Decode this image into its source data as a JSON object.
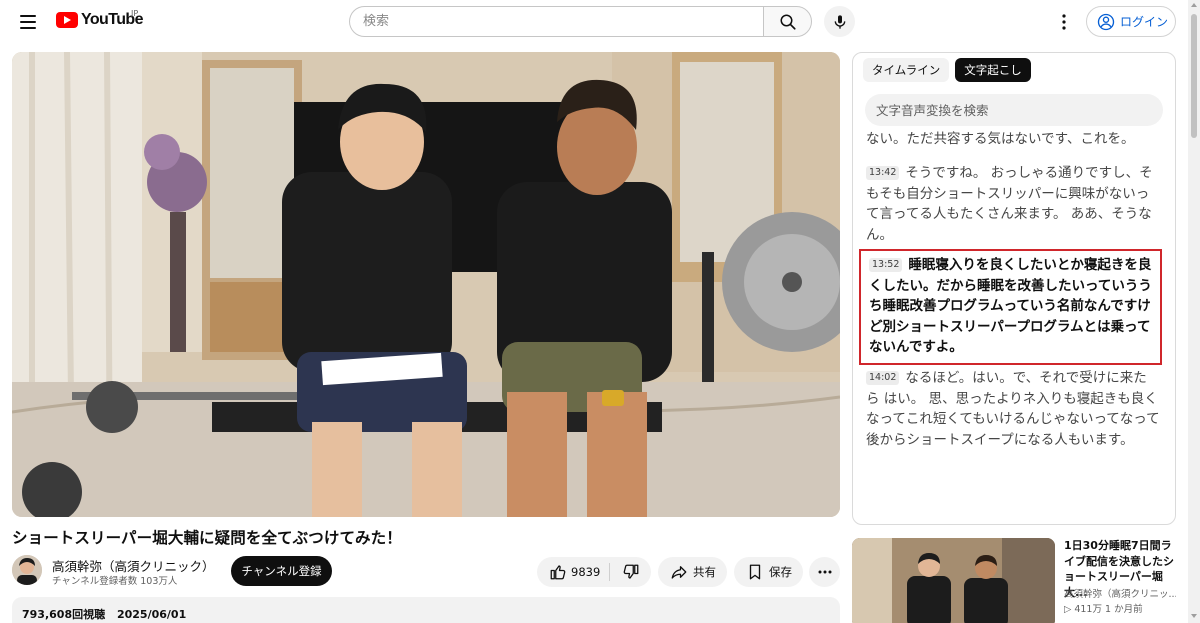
{
  "header": {
    "logo_text": "YouTube",
    "region": "JP",
    "search_placeholder": "検索",
    "login_label": "ログイン"
  },
  "video": {
    "title": "ショートスリーパー堀大輔に疑問を全てぶつけてみた！",
    "channel": "高須幹弥（高須クリニック）",
    "subscribers": "チャンネル登録者数 103万人",
    "subscribe_label": "チャンネル登録",
    "like_count": "9839",
    "share_label": "共有",
    "save_label": "保存",
    "views": "793,608回視聴",
    "date": "2025/06/01"
  },
  "panel": {
    "tabs": [
      {
        "label": "タイムライン",
        "active": false
      },
      {
        "label": "文字起こし",
        "active": true
      }
    ],
    "search_placeholder": "文字音声変換を検索",
    "segments": [
      {
        "time": "",
        "text": "ない。ただ共容する気はないです、これを。"
      },
      {
        "time": "13:42",
        "text": "そうですね。 おっしゃる通りですし、そもそも自分ショートスリッパーに興味がないって言ってる人もたくさん来ます。 ああ、そうなん。"
      },
      {
        "time": "13:52",
        "text": "睡眠寝入りを良くしたいとか寝起きを良くしたい。だから睡眠を改善したいっていううち睡眠改善プログラムっていう名前なんですけど別ショートスリーパープログラムとは乗ってないんですよ。",
        "active": true
      },
      {
        "time": "14:02",
        "text": "なるほど。はい。で、それで受けに来たら はい。 思、思ったよりネ入りも寝起きも良くなってこれ短くてもいけるんじゃないってなって後からショートスイープになる人もいます。"
      }
    ]
  },
  "recommendation": {
    "title": "1日30分睡眠7日間ライブ配信を決意したショートスリーパー堀大...",
    "channel": "高須幹弥（高須クリニッ...",
    "views": "▷ 411万",
    "age": "1 か月前"
  },
  "colors": {
    "brand_red": "#ff0000",
    "link_blue": "#065fd4",
    "highlight_border": "#d0262b"
  }
}
